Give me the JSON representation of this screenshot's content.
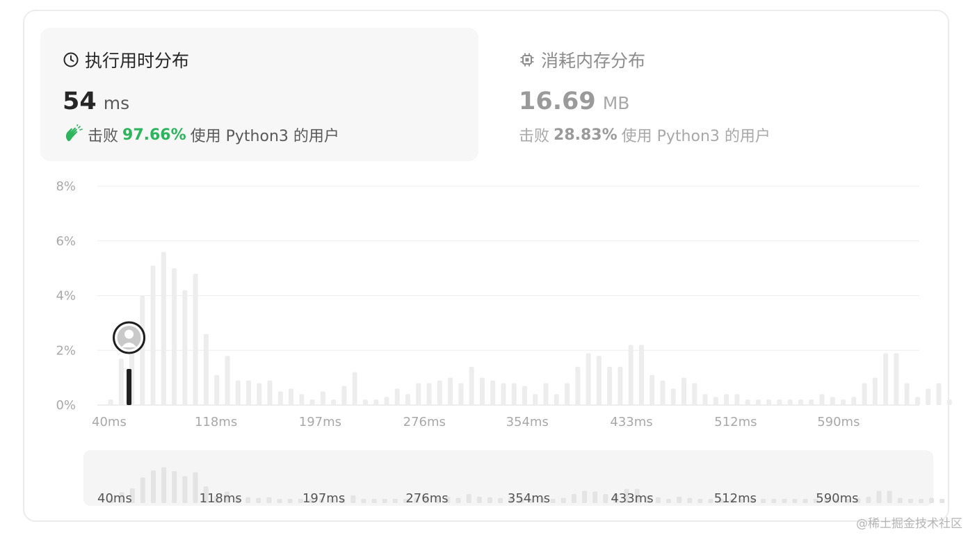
{
  "runtime": {
    "title": "执行用时分布",
    "value": "54",
    "unit": "ms",
    "beat_prefix": "击败",
    "beat_pct": "97.66%",
    "beat_suffix": "使用 Python3 的用户",
    "icon": "clock-icon"
  },
  "memory": {
    "title": "消耗内存分布",
    "value": "16.69",
    "unit": "MB",
    "beat_prefix": "击败",
    "beat_pct": "28.83%",
    "beat_suffix": "使用 Python3 的用户",
    "icon": "chip-icon"
  },
  "colors": {
    "accent_green": "#2db55d",
    "bar": "#ededed",
    "marker": "#1f1f1f"
  },
  "watermark": "@稀土掘金技术社区",
  "chart_data": {
    "type": "bar",
    "yticks": [
      "0%",
      "2%",
      "4%",
      "6%",
      "8%"
    ],
    "ylim": [
      0,
      8
    ],
    "xlim": [
      40,
      650
    ],
    "xticks": [
      "40ms",
      "118ms",
      "197ms",
      "276ms",
      "354ms",
      "433ms",
      "512ms",
      "590ms"
    ],
    "xtick_values": [
      40,
      118,
      197,
      276,
      354,
      433,
      512,
      590
    ],
    "bin_width": 8.05,
    "grid": true,
    "user_value": 54,
    "values": [
      0.2,
      1.7,
      2.3,
      4.0,
      5.1,
      5.6,
      5.0,
      4.2,
      4.8,
      2.6,
      1.1,
      1.8,
      0.9,
      0.9,
      0.8,
      0.9,
      0.5,
      0.6,
      0.4,
      0.2,
      0.5,
      0.2,
      0.7,
      1.2,
      0.2,
      0.2,
      0.3,
      0.6,
      0.4,
      0.8,
      0.8,
      0.9,
      1.0,
      0.8,
      1.4,
      1.0,
      0.9,
      0.8,
      0.8,
      0.7,
      0.4,
      0.8,
      0.4,
      0.8,
      1.4,
      1.9,
      1.8,
      1.4,
      1.4,
      2.2,
      2.2,
      1.1,
      0.9,
      0.6,
      1.0,
      0.8,
      0.4,
      0.3,
      0.4,
      0.4,
      0.2,
      0.2,
      0.2,
      0.2,
      0.2,
      0.2,
      0.2,
      0.4,
      0.3,
      0.2,
      0.3,
      0.8,
      1.0,
      1.9,
      1.9,
      0.8,
      0.3,
      0.6,
      0.8,
      0.2
    ]
  }
}
